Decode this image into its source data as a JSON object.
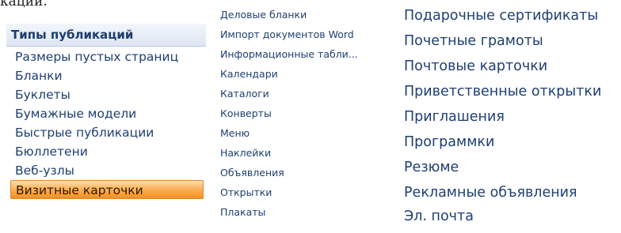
{
  "cut_text": "кации.",
  "types_panel": {
    "title": "Типы публикаций",
    "items": [
      {
        "label": "Размеры пустых страниц"
      },
      {
        "label": "Бланки"
      },
      {
        "label": "Буклеты"
      },
      {
        "label": "Бумажные модели"
      },
      {
        "label": "Быстрые публикации"
      },
      {
        "label": "Бюллетени"
      },
      {
        "label": "Веб-узлы"
      },
      {
        "label": "Визитные карточки"
      }
    ],
    "selected_index": 7,
    "selected_color": "#f9a040"
  },
  "middle_column": {
    "items": [
      {
        "label": "Деловые бланки"
      },
      {
        "label": "Импорт документов Word"
      },
      {
        "label": "Информационные табли..."
      },
      {
        "label": "Календари"
      },
      {
        "label": "Каталоги"
      },
      {
        "label": "Конверты"
      },
      {
        "label": "Меню"
      },
      {
        "label": "Наклейки"
      },
      {
        "label": "Объявления"
      },
      {
        "label": "Открытки"
      },
      {
        "label": "Плакаты"
      }
    ]
  },
  "right_column": {
    "items": [
      {
        "label": "Подарочные сертификаты"
      },
      {
        "label": "Почетные грамоты"
      },
      {
        "label": "Почтовые карточки"
      },
      {
        "label": "Приветственные открытки"
      },
      {
        "label": "Приглашения"
      },
      {
        "label": "Программки"
      },
      {
        "label": "Резюме"
      },
      {
        "label": "Рекламные объявления"
      },
      {
        "label": "Эл. почта"
      }
    ]
  },
  "colors": {
    "text": "#1e3f73",
    "header_bg": "#dde6f3",
    "selected_bg": "#f9a040"
  }
}
